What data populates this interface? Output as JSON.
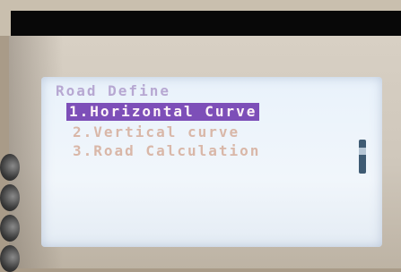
{
  "screen": {
    "title": "Road Define",
    "menu_items": [
      {
        "label": "1.Horizontal Curve",
        "selected": true
      },
      {
        "label": "2.Vertical curve",
        "selected": false
      },
      {
        "label": "3.Road Calculation",
        "selected": false
      }
    ]
  },
  "colors": {
    "highlight": "#7d4fb8",
    "screen_bg": "#eef4fa",
    "text": "#d9b7a8"
  }
}
